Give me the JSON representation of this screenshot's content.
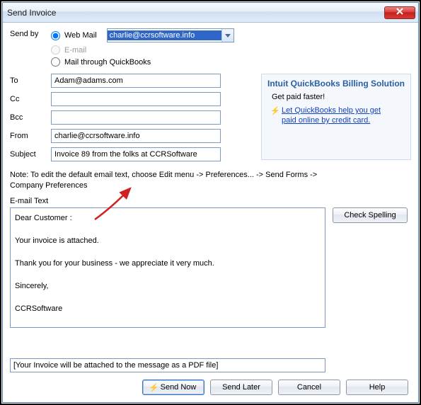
{
  "window": {
    "title": "Send Invoice"
  },
  "sendby": {
    "label": "Send by",
    "options": {
      "webmail": "Web Mail",
      "email": "E-mail",
      "quickbooks": "Mail through QuickBooks"
    },
    "dropdown_value": "charlie@ccrsoftware.info"
  },
  "fields": {
    "to": {
      "label": "To",
      "value": "Adam@adams.com"
    },
    "cc": {
      "label": "Cc",
      "value": ""
    },
    "bcc": {
      "label": "Bcc",
      "value": ""
    },
    "from": {
      "label": "From",
      "value": "charlie@ccrsoftware.info"
    },
    "subject": {
      "label": "Subject",
      "value": "Invoice 89 from the folks at CCRSoftware"
    }
  },
  "sidepanel": {
    "title": "Intuit QuickBooks Billing Solution",
    "subtitle": "Get paid faster!",
    "link_line1": "Let QuickBooks help you get ",
    "link_line2": "paid online by credit card."
  },
  "note": "Note: To edit the default email text, choose Edit menu -> Preferences... -> Send Forms -> Company Preferences",
  "emailtext": {
    "label": "E-mail Text",
    "body": "Dear Customer :\n\nYour invoice is attached.\n\nThank you for your business - we appreciate it very much.\n\nSincerely,\n\nCCRSoftware"
  },
  "attachment_note": "[Your Invoice will be attached to the message as a PDF file]",
  "buttons": {
    "check_spelling": "Check Spelling",
    "send_now": "Send Now",
    "send_later": "Send Later",
    "cancel": "Cancel",
    "help": "Help"
  }
}
